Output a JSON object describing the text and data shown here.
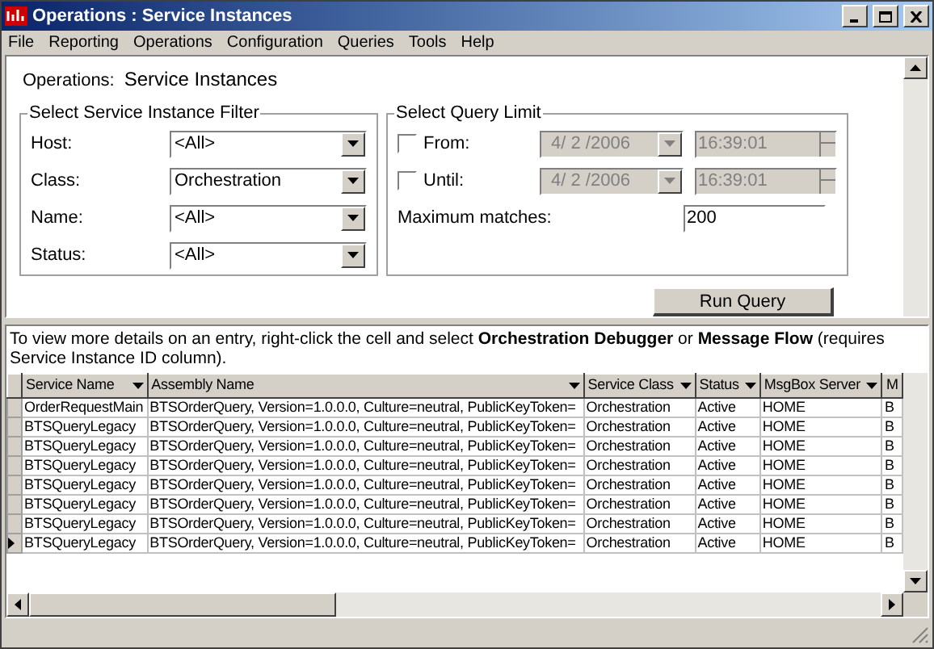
{
  "window": {
    "title": "Operations : Service Instances"
  },
  "menu": [
    "File",
    "Reporting",
    "Operations",
    "Configuration",
    "Queries",
    "Tools",
    "Help"
  ],
  "header": {
    "label": "Operations:",
    "title": "Service Instances"
  },
  "filter": {
    "title": "Select Service Instance Filter",
    "fields": [
      {
        "label": "Host:",
        "value": "<All>"
      },
      {
        "label": "Class:",
        "value": "Orchestration"
      },
      {
        "label": "Name:",
        "value": "<All>"
      },
      {
        "label": "Status:",
        "value": "<All>"
      }
    ]
  },
  "query_limit": {
    "title": "Select Query Limit",
    "ranges": [
      {
        "label": "From:",
        "checked": false,
        "date": "4/ 2 /2006",
        "time": "16:39:01",
        "disabled": true
      },
      {
        "label": "Until:",
        "checked": false,
        "date": "4/ 2 /2006",
        "time": "16:39:01",
        "disabled": true
      }
    ],
    "max_label": "Maximum matches:",
    "max_value": "200"
  },
  "run_button": "Run Query",
  "info": "To view more details on an entry, right-click the cell and select **Orchestration Debugger** or **Message Flow** (requires Service Instance ID column).",
  "table": {
    "columns": [
      {
        "label": "Service Name",
        "sortable": true
      },
      {
        "label": "Assembly Name",
        "sortable": true
      },
      {
        "label": "Service Class",
        "sortable": true
      },
      {
        "label": "Status",
        "sortable": true
      },
      {
        "label": "MsgBox Server",
        "sortable": true
      },
      {
        "label": "M",
        "sortable": false
      }
    ],
    "rows": [
      {
        "selected": false,
        "cells": [
          "OrderRequestMain",
          "BTSOrderQuery, Version=1.0.0.0, Culture=neutral, PublicKeyToken=",
          "Orchestration",
          "Active",
          "HOME",
          "B"
        ]
      },
      {
        "selected": false,
        "cells": [
          "BTSQueryLegacy",
          "BTSOrderQuery, Version=1.0.0.0, Culture=neutral, PublicKeyToken=",
          "Orchestration",
          "Active",
          "HOME",
          "B"
        ]
      },
      {
        "selected": false,
        "cells": [
          "BTSQueryLegacy",
          "BTSOrderQuery, Version=1.0.0.0, Culture=neutral, PublicKeyToken=",
          "Orchestration",
          "Active",
          "HOME",
          "B"
        ]
      },
      {
        "selected": false,
        "cells": [
          "BTSQueryLegacy",
          "BTSOrderQuery, Version=1.0.0.0, Culture=neutral, PublicKeyToken=",
          "Orchestration",
          "Active",
          "HOME",
          "B"
        ]
      },
      {
        "selected": false,
        "cells": [
          "BTSQueryLegacy",
          "BTSOrderQuery, Version=1.0.0.0, Culture=neutral, PublicKeyToken=",
          "Orchestration",
          "Active",
          "HOME",
          "B"
        ]
      },
      {
        "selected": false,
        "cells": [
          "BTSQueryLegacy",
          "BTSOrderQuery, Version=1.0.0.0, Culture=neutral, PublicKeyToken=",
          "Orchestration",
          "Active",
          "HOME",
          "B"
        ]
      },
      {
        "selected": false,
        "cells": [
          "BTSQueryLegacy",
          "BTSOrderQuery, Version=1.0.0.0, Culture=neutral, PublicKeyToken=",
          "Orchestration",
          "Active",
          "HOME",
          "B"
        ]
      },
      {
        "selected": true,
        "cells": [
          "BTSQueryLegacy",
          "BTSOrderQuery, Version=1.0.0.0, Culture=neutral, PublicKeyToken=",
          "Orchestration",
          "Active",
          "HOME",
          "B"
        ]
      }
    ]
  }
}
